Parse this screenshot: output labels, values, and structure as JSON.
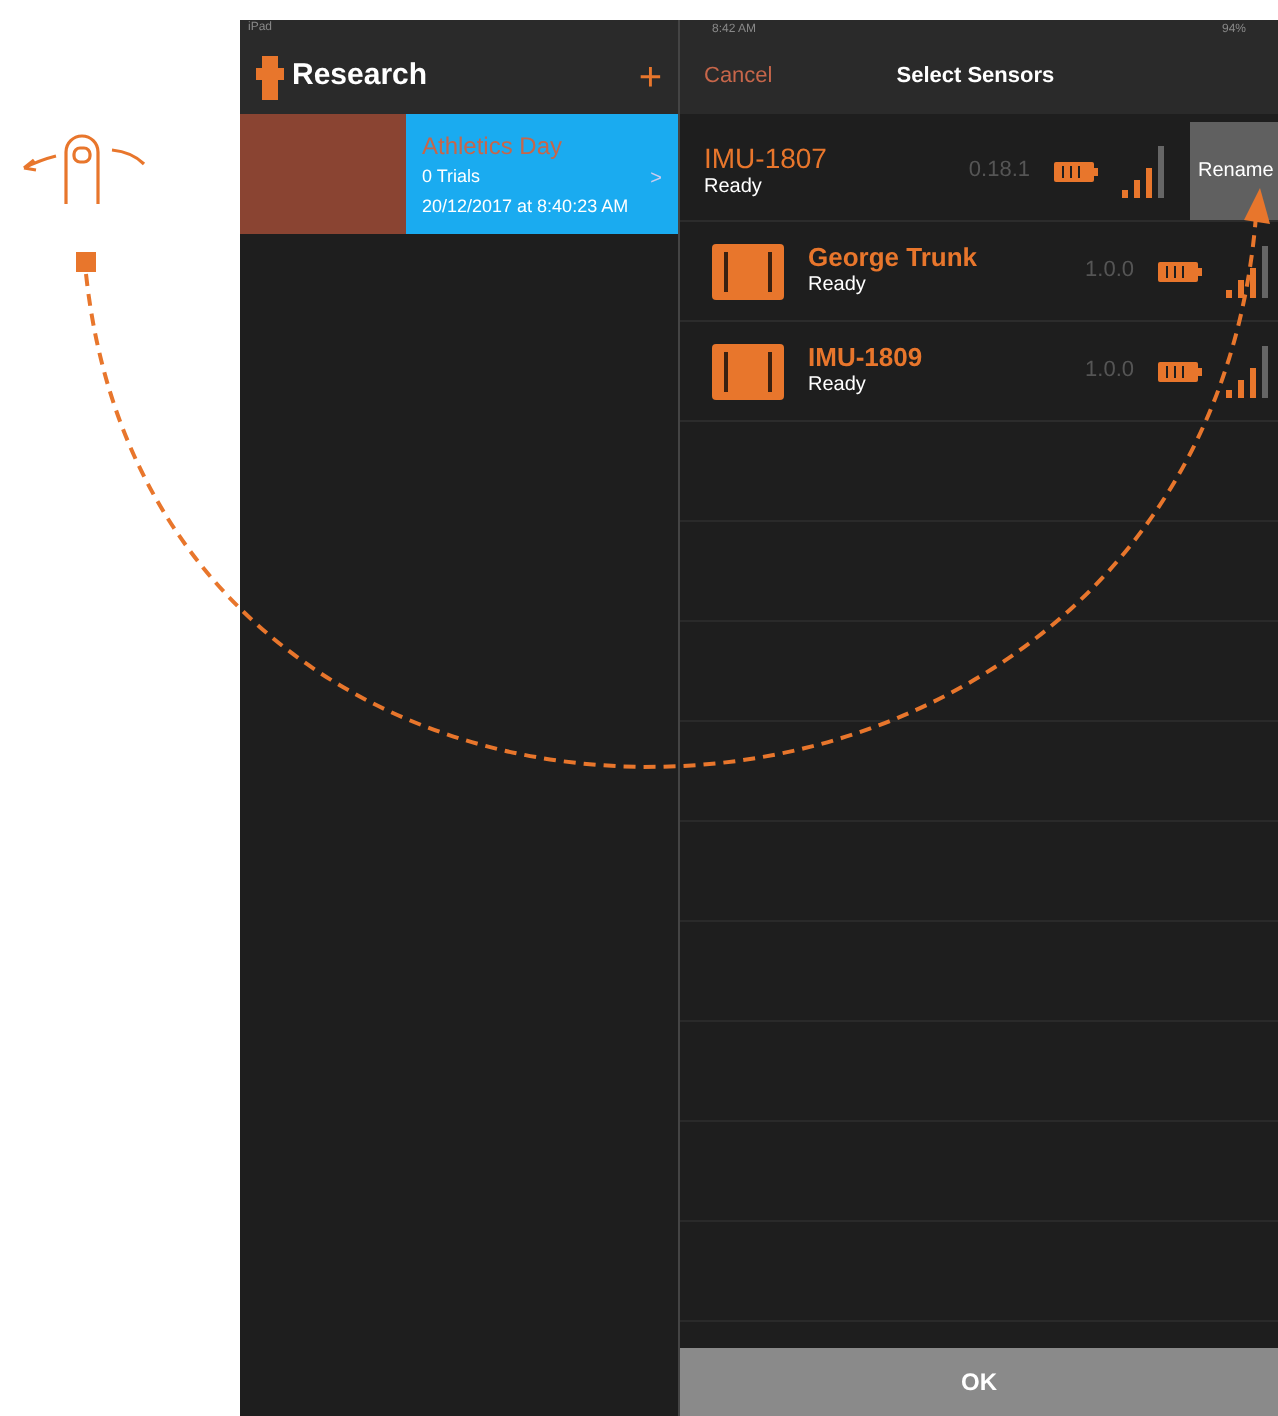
{
  "left_status": {
    "device": "iPad"
  },
  "left_nav": {
    "title": "Research",
    "add": "+"
  },
  "session": {
    "title": "Athletics Day",
    "trials": "0 Trials",
    "date": "20/12/2017 at 8:40:23 AM",
    "chevron": ">",
    "selected": true
  },
  "right_status": {
    "time": "8:42 AM",
    "battery": "94%"
  },
  "right_nav": {
    "cancel": "Cancel",
    "title": "Select Sensors"
  },
  "sensors": [
    {
      "kind": "swiped",
      "name": "IMU-1807",
      "status": "Ready",
      "version": "0.18.1",
      "action": "Rename"
    },
    {
      "kind": "normal",
      "name": "George Trunk",
      "status": "Ready",
      "version": "1.0.0"
    },
    {
      "kind": "normal",
      "name": "IMU-1809",
      "status": "Ready",
      "version": "1.0.0"
    }
  ],
  "ok_button": "OK"
}
